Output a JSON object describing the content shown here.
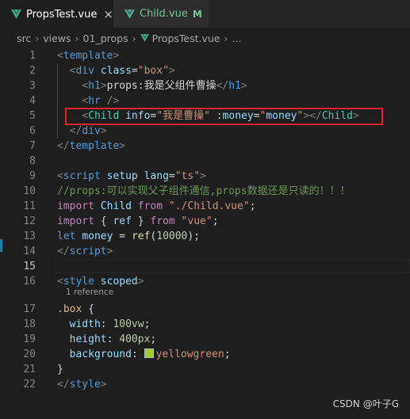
{
  "tabs": [
    {
      "label": "PropsTest.vue",
      "close": "×"
    },
    {
      "label": "Child.vue",
      "status": "M"
    }
  ],
  "breadcrumb": {
    "parts": [
      "src",
      "views",
      "01_props",
      "PropsTest.vue",
      "..."
    ]
  },
  "editor": {
    "current_line": "15",
    "lines": [
      {
        "n": "1"
      },
      {
        "n": "2"
      },
      {
        "n": "3"
      },
      {
        "n": "4"
      },
      {
        "n": "5"
      },
      {
        "n": "6"
      },
      {
        "n": "7"
      },
      {
        "n": "8"
      },
      {
        "n": "9"
      },
      {
        "n": "10"
      },
      {
        "n": "11"
      },
      {
        "n": "12"
      },
      {
        "n": "13"
      },
      {
        "n": "14"
      },
      {
        "n": "15"
      },
      {
        "n": "16"
      },
      {
        "n": "17"
      },
      {
        "n": "18"
      },
      {
        "n": "19"
      },
      {
        "n": "20"
      },
      {
        "n": "21"
      },
      {
        "n": "22"
      }
    ],
    "codelens": "1 reference",
    "swatch_color": "#9acd32"
  },
  "watermark": "CSDN @叶子G",
  "colors": {
    "tag": "#569cd6",
    "attr": "#9cdcfe",
    "string": "#ce9178",
    "keyword": "#c586c0",
    "comment": "#6a9955",
    "highlight_box": "#e0242c"
  }
}
